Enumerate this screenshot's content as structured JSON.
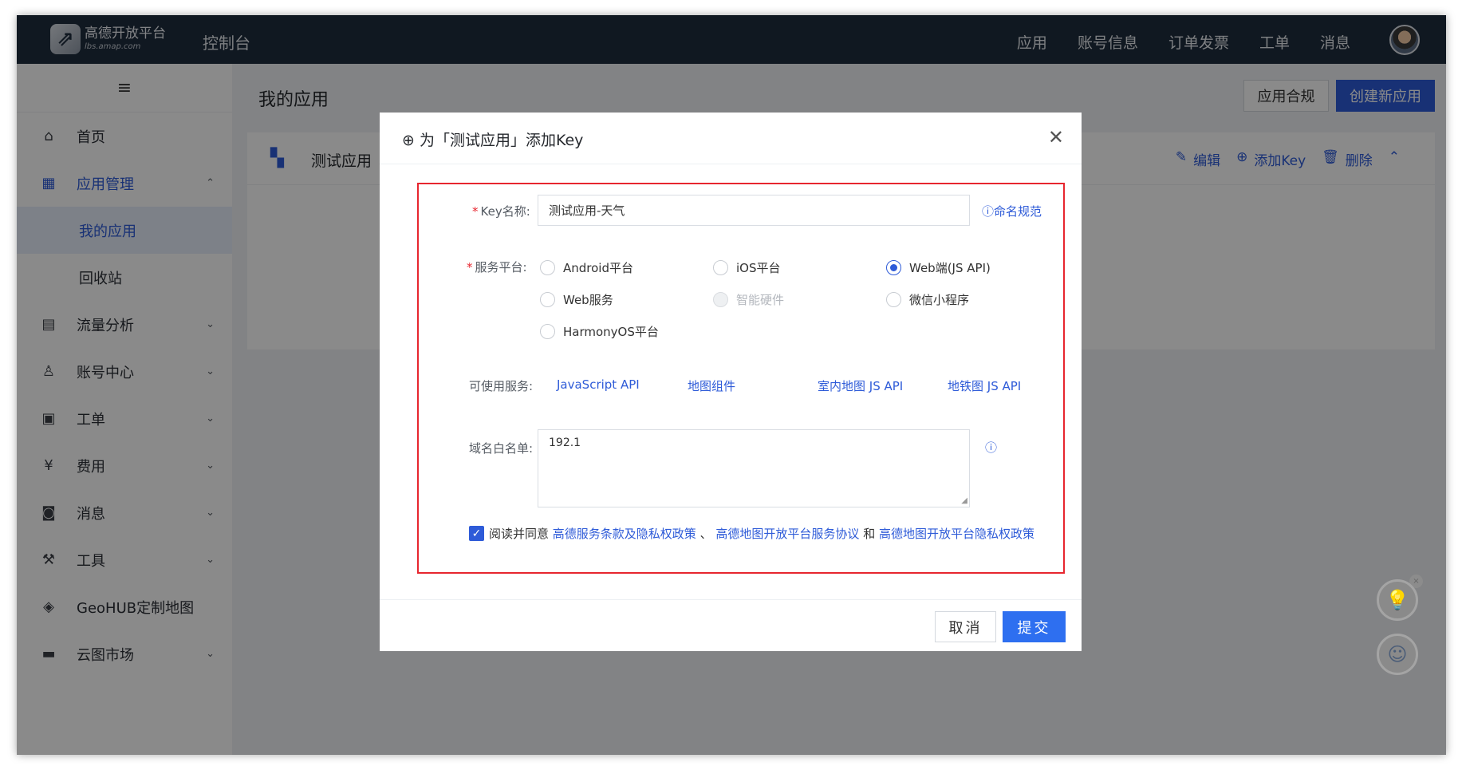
{
  "header": {
    "logo_title": "高德开放平台",
    "logo_subtitle": "lbs.amap.com",
    "console_label": "控制台",
    "nav": [
      "应用",
      "账号信息",
      "订单发票",
      "工单",
      "消息"
    ]
  },
  "sidebar": {
    "toggle_icon": "≡",
    "items": [
      {
        "label": "首页",
        "icon": "home-icon",
        "glyph": "⌂",
        "active": false,
        "has_chevron": false
      },
      {
        "label": "应用管理",
        "icon": "grid-icon",
        "glyph": "▦",
        "active": true,
        "has_chevron": true,
        "chevron": "⌃"
      },
      {
        "label": "流量分析",
        "icon": "chart-icon",
        "glyph": "▤",
        "active": false,
        "has_chevron": true,
        "chevron": "⌄"
      },
      {
        "label": "账号中心",
        "icon": "user-icon",
        "glyph": "♙",
        "active": false,
        "has_chevron": true,
        "chevron": "⌄"
      },
      {
        "label": "工单",
        "icon": "ticket-icon",
        "glyph": "▣",
        "active": false,
        "has_chevron": true,
        "chevron": "⌄"
      },
      {
        "label": "费用",
        "icon": "currency-icon",
        "glyph": "¥",
        "active": false,
        "has_chevron": true,
        "chevron": "⌄"
      },
      {
        "label": "消息",
        "icon": "message-icon",
        "glyph": "◙",
        "active": false,
        "has_chevron": true,
        "chevron": "⌄"
      },
      {
        "label": "工具",
        "icon": "wrench-icon",
        "glyph": "⚒",
        "active": false,
        "has_chevron": true,
        "chevron": "⌄"
      },
      {
        "label": "GeoHUB定制地图",
        "icon": "layers-icon",
        "glyph": "◈",
        "active": false,
        "has_chevron": false
      },
      {
        "label": "云图市场",
        "icon": "store-icon",
        "glyph": "▬",
        "active": false,
        "has_chevron": true,
        "chevron": "⌄"
      }
    ],
    "sub_items": [
      {
        "label": "我的应用",
        "selected": true
      },
      {
        "label": "回收站",
        "selected": false
      }
    ]
  },
  "main": {
    "page_title": "我的应用",
    "compliance_button": "应用合规",
    "create_button": "创建新应用",
    "app_card": {
      "name": "测试应用",
      "actions": [
        "编辑",
        "添加Key",
        "删除"
      ]
    }
  },
  "modal": {
    "title": "为「测试应用」添加Key",
    "key_name_label": "Key名称:",
    "key_name_value": "测试应用-天气",
    "naming_rule_link": "命名规范",
    "platform_label": "服务平台:",
    "platforms": [
      {
        "label": "Android平台",
        "checked": false,
        "disabled": false
      },
      {
        "label": "iOS平台",
        "checked": false,
        "disabled": false
      },
      {
        "label": "Web端(JS API)",
        "checked": true,
        "disabled": false
      },
      {
        "label": "Web服务",
        "checked": false,
        "disabled": false
      },
      {
        "label": "智能硬件",
        "checked": false,
        "disabled": true
      },
      {
        "label": "微信小程序",
        "checked": false,
        "disabled": false
      },
      {
        "label": "HarmonyOS平台",
        "checked": false,
        "disabled": false
      }
    ],
    "services_label": "可使用服务:",
    "services": [
      "JavaScript API",
      "地图组件",
      "室内地图 JS API",
      "地铁图 JS API"
    ],
    "whitelist_label": "域名白名单:",
    "whitelist_value": "192.1",
    "agree_prefix": "阅读并同意",
    "agree_link_1": "高德服务条款及隐私权政策",
    "agree_sep": "、",
    "agree_link_2": "高德地图开放平台服务协议",
    "agree_and": "和",
    "agree_link_3": "高德地图开放平台隐私权政策",
    "agree_checked": true,
    "cancel_button": "取消",
    "submit_button": "提交"
  },
  "colors": {
    "header_bg": "#1f2d3d",
    "primary": "#2e5bd8",
    "highlight_border": "#e7262f"
  }
}
